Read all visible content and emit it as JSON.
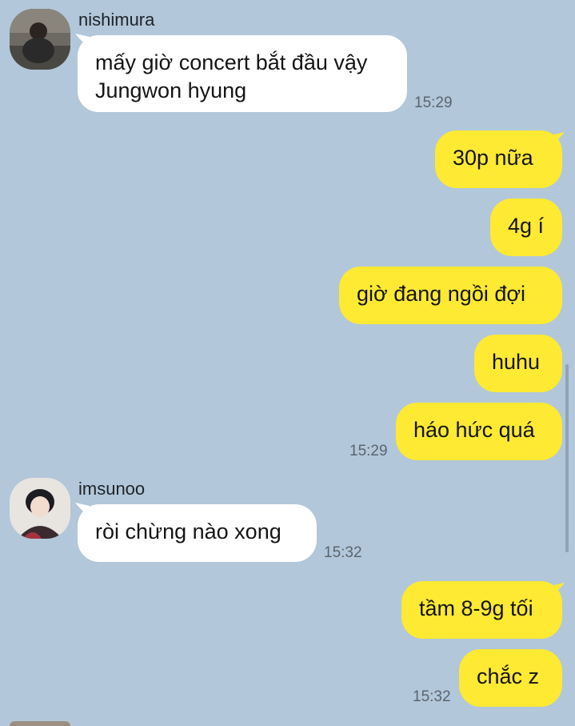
{
  "messages": [
    {
      "sender": "nishimura",
      "text": "mấy giờ concert bắt đầu vậy Jungwon hyung",
      "time": "15:29"
    },
    {
      "sender": "me",
      "text": "30p nữa"
    },
    {
      "sender": "me",
      "text": "4g í"
    },
    {
      "sender": "me",
      "text": "giờ đang ngồi đợi"
    },
    {
      "sender": "me",
      "text": "huhu"
    },
    {
      "sender": "me",
      "text": "háo hức quá",
      "time": "15:29"
    },
    {
      "sender": "imsunoo",
      "text": "ròi chừng nào xong",
      "time": "15:32"
    },
    {
      "sender": "me",
      "text": "tầm 8-9g tối"
    },
    {
      "sender": "me",
      "text": "chắc z",
      "time": "15:32"
    }
  ],
  "colors": {
    "background": "#b2c7d9",
    "incoming_bubble": "#ffffff",
    "outgoing_bubble": "#fee933"
  }
}
